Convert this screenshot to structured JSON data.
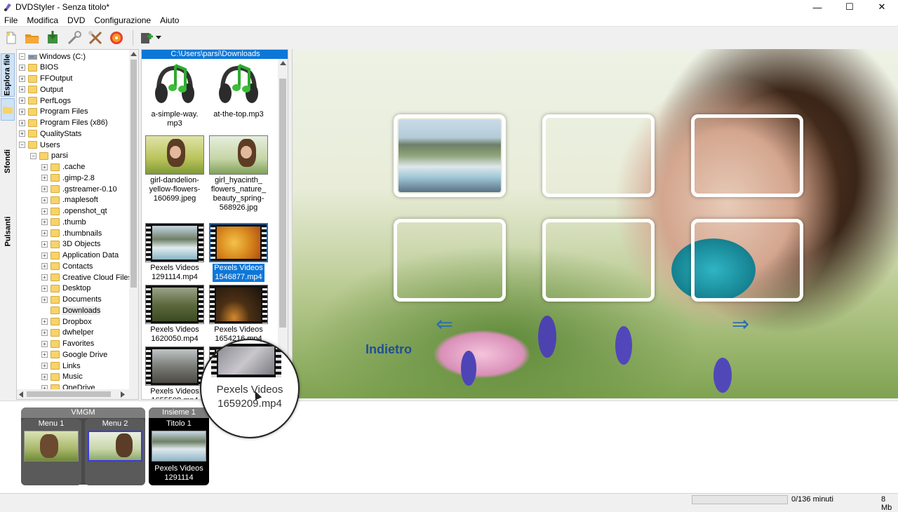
{
  "window": {
    "title": "DVDStyler - Senza titolo*",
    "minimize": "—",
    "maximize": "☐",
    "close": "✕"
  },
  "menu": [
    "File",
    "Modifica",
    "DVD",
    "Configurazione",
    "Aiuto"
  ],
  "toolbar": {
    "icons": [
      "new-icon",
      "open-icon",
      "save-icon",
      "settings-icon",
      "tools-icon",
      "burn-icon",
      "add-icon",
      "dropdown-icon"
    ]
  },
  "side_tabs": [
    "Esplora file",
    "Sfondi",
    "Pulsanti"
  ],
  "tree": {
    "root": "Windows (C:)",
    "items": [
      {
        "label": "BIOS",
        "level": 1,
        "exp": "+"
      },
      {
        "label": "FFOutput",
        "level": 1,
        "exp": "+"
      },
      {
        "label": "Output",
        "level": 1,
        "exp": "+"
      },
      {
        "label": "PerfLogs",
        "level": 1,
        "exp": "+"
      },
      {
        "label": "Program Files",
        "level": 1,
        "exp": "+"
      },
      {
        "label": "Program Files (x86)",
        "level": 1,
        "exp": "+"
      },
      {
        "label": "QualityStats",
        "level": 1,
        "exp": "+"
      },
      {
        "label": "Users",
        "level": 1,
        "exp": "−"
      },
      {
        "label": "parsi",
        "level": 2,
        "exp": "−"
      },
      {
        "label": ".cache",
        "level": 3,
        "exp": "+"
      },
      {
        "label": ".gimp-2.8",
        "level": 3,
        "exp": "+"
      },
      {
        "label": ".gstreamer-0.10",
        "level": 3,
        "exp": "+"
      },
      {
        "label": ".maplesoft",
        "level": 3,
        "exp": "+"
      },
      {
        "label": ".openshot_qt",
        "level": 3,
        "exp": "+"
      },
      {
        "label": ".thumb",
        "level": 3,
        "exp": "+"
      },
      {
        "label": ".thumbnails",
        "level": 3,
        "exp": "+"
      },
      {
        "label": "3D Objects",
        "level": 3,
        "exp": "+"
      },
      {
        "label": "Application Data",
        "level": 3,
        "exp": "+"
      },
      {
        "label": "Contacts",
        "level": 3,
        "exp": "+"
      },
      {
        "label": "Creative Cloud Files",
        "level": 3,
        "exp": "+"
      },
      {
        "label": "Desktop",
        "level": 3,
        "exp": "+"
      },
      {
        "label": "Documents",
        "level": 3,
        "exp": "+"
      },
      {
        "label": "Downloads",
        "level": 3,
        "exp": "",
        "selected": true
      },
      {
        "label": "Dropbox",
        "level": 3,
        "exp": "+"
      },
      {
        "label": "dwhelper",
        "level": 3,
        "exp": "+"
      },
      {
        "label": "Favorites",
        "level": 3,
        "exp": "+"
      },
      {
        "label": "Google Drive",
        "level": 3,
        "exp": "+"
      },
      {
        "label": "Links",
        "level": 3,
        "exp": "+"
      },
      {
        "label": "Music",
        "level": 3,
        "exp": "+"
      },
      {
        "label": "OneDrive",
        "level": 3,
        "exp": "+"
      }
    ]
  },
  "files": {
    "path": "C:\\Users\\parsi\\Downloads",
    "items": [
      {
        "label": "a-simple-way.\nmp3",
        "kind": "audio"
      },
      {
        "label": "at-the-top.mp3",
        "kind": "audio"
      },
      {
        "label": "girl-dandelion-\nyellow-flowers-\n160699.jpeg",
        "kind": "image"
      },
      {
        "label": "girl_hyacinth_\nflowers_nature_\nbeauty_spring-\n568926.jpg",
        "kind": "image"
      },
      {
        "label": "Pexels Videos\n1291114.mp4",
        "kind": "video"
      },
      {
        "label": "Pexels Videos\n1546877.mp4",
        "kind": "video",
        "selected": true
      },
      {
        "label": "Pexels Videos\n1620050.mp4",
        "kind": "video"
      },
      {
        "label": "Pexels Videos\n1654216.mp4",
        "kind": "video"
      },
      {
        "label": "Pexels Videos\n1655508.mp4",
        "kind": "video"
      },
      {
        "label": "",
        "kind": "video"
      }
    ]
  },
  "magnifier": {
    "line1": "Pexels Videos",
    "line2": "1659209.mp4"
  },
  "preview": {
    "back_label": "Indietro",
    "left_arrow": "⇐",
    "right_arrow": "⇒"
  },
  "titleset": {
    "groups": [
      {
        "title": "VMGM",
        "cards": [
          {
            "title": "Menu 1",
            "sub": ""
          },
          {
            "title": "Menu 2",
            "sub": ""
          }
        ]
      },
      {
        "title": "Insieme 1",
        "cards": [
          {
            "title": "Titolo 1",
            "sub": "Pexels Videos\n1291114"
          }
        ]
      }
    ]
  },
  "status": {
    "minutes": "0/136 minuti",
    "size": "8 Mb",
    "progress": 0
  }
}
